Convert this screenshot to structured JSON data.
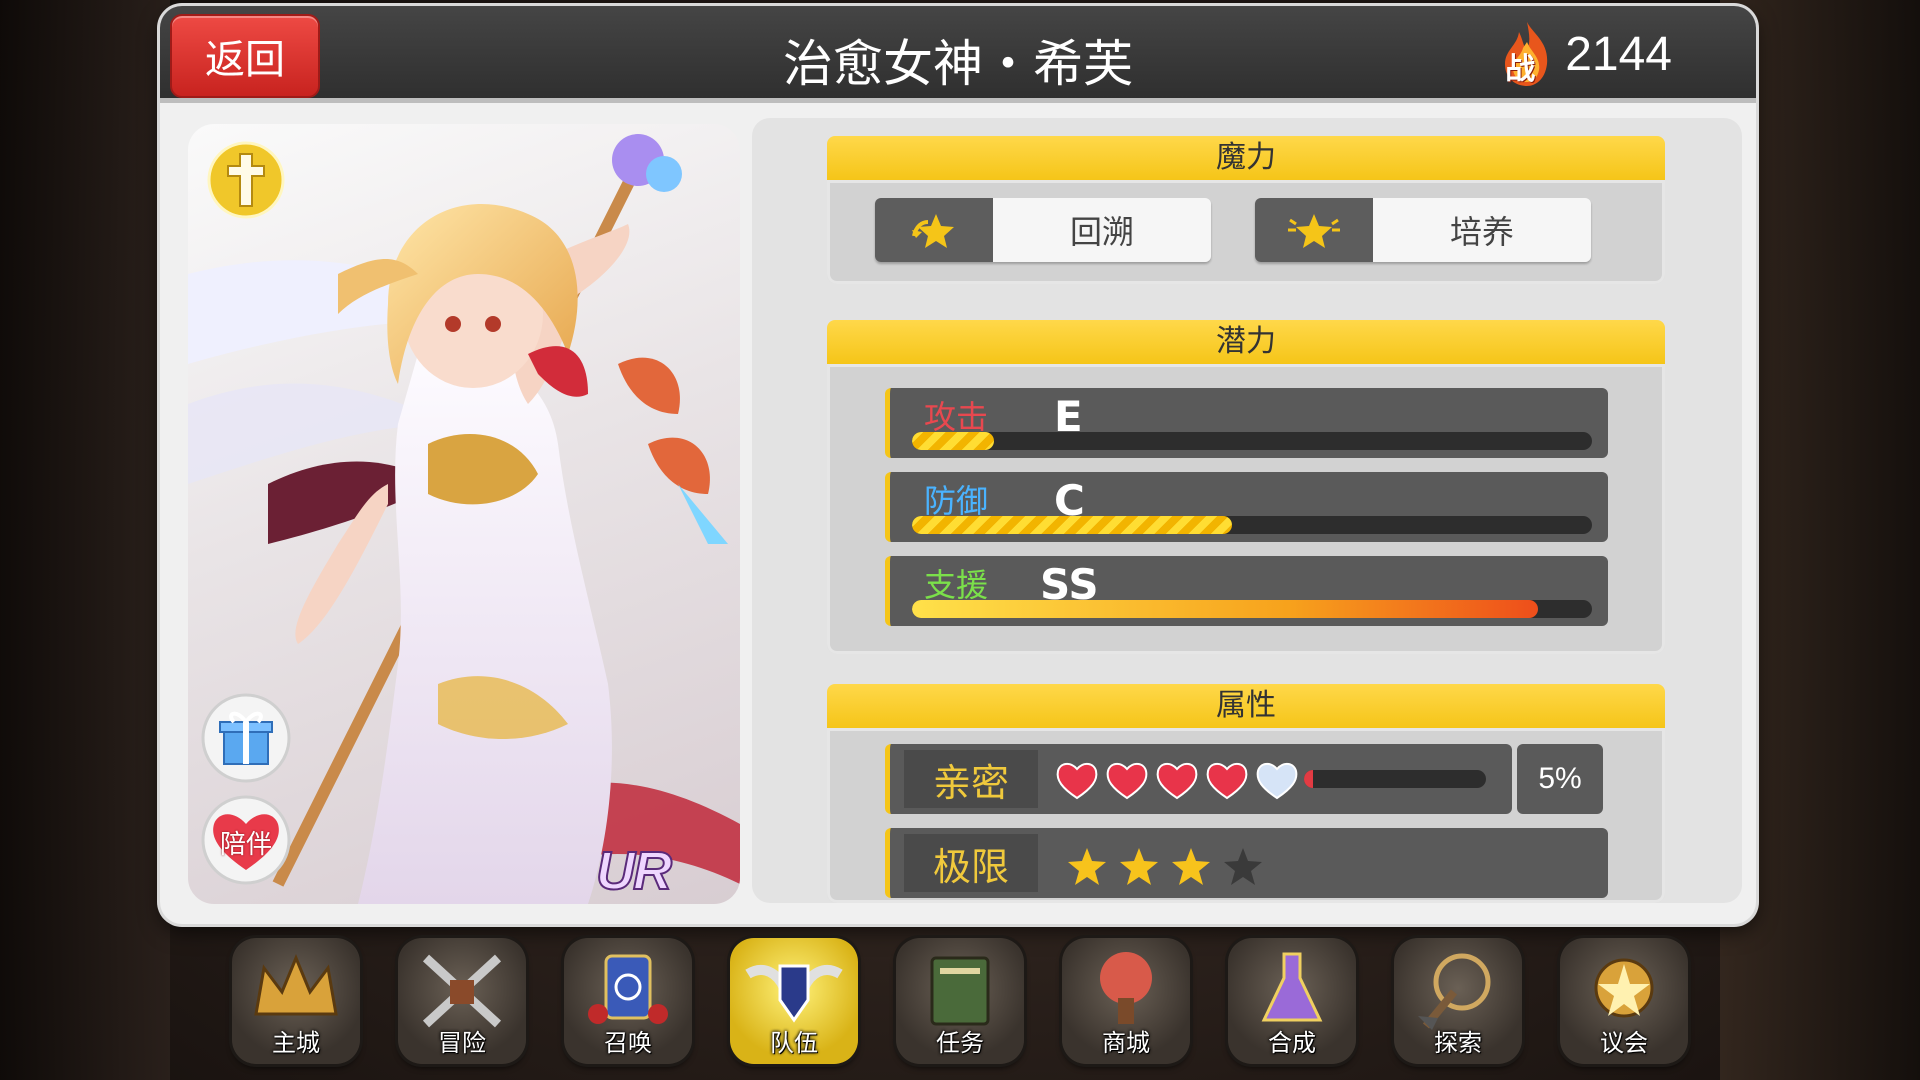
{
  "header": {
    "back_label": "返回",
    "title": "治愈女神・希芙",
    "power_badge": "战",
    "power_value": "2144"
  },
  "card": {
    "rarity": "UR",
    "accompany_label": "陪伴"
  },
  "magic": {
    "header": "魔力",
    "buttons": [
      {
        "label": "回溯",
        "icon": "star-back-icon"
      },
      {
        "label": "培养",
        "icon": "star-shine-icon"
      }
    ]
  },
  "potential": {
    "header": "潜力",
    "rows": [
      {
        "label": "攻击",
        "grade": "E",
        "fill": 0.12,
        "label_color": "#e8484f"
      },
      {
        "label": "防御",
        "grade": "C",
        "fill": 0.47,
        "label_color": "#4ab3ff"
      },
      {
        "label": "支援",
        "grade": "SS",
        "fill": 0.92,
        "label_color": "#7be04a"
      }
    ]
  },
  "attributes": {
    "header": "属性",
    "affinity": {
      "label": "亲密",
      "hearts_filled": 4,
      "hearts_total": 5,
      "progress": 0.05,
      "percent": "5%"
    },
    "limit": {
      "label": "极限",
      "stars_filled": 3,
      "stars_total": 4
    }
  },
  "nav": [
    {
      "label": "主城",
      "icon": "crown-icon"
    },
    {
      "label": "冒险",
      "icon": "crossed-swords-icon"
    },
    {
      "label": "召唤",
      "icon": "summon-card-icon"
    },
    {
      "label": "队伍",
      "icon": "winged-shield-icon",
      "active": true
    },
    {
      "label": "任务",
      "icon": "quest-book-icon"
    },
    {
      "label": "商城",
      "icon": "shop-tree-icon"
    },
    {
      "label": "合成",
      "icon": "potion-flask-icon"
    },
    {
      "label": "探索",
      "icon": "shovel-compass-icon"
    },
    {
      "label": "议会",
      "icon": "council-emblem-icon"
    }
  ],
  "colors": {
    "accent_yellow": "#f5c518",
    "back_red": "#d8302b",
    "panel": "#f0f0f0"
  }
}
